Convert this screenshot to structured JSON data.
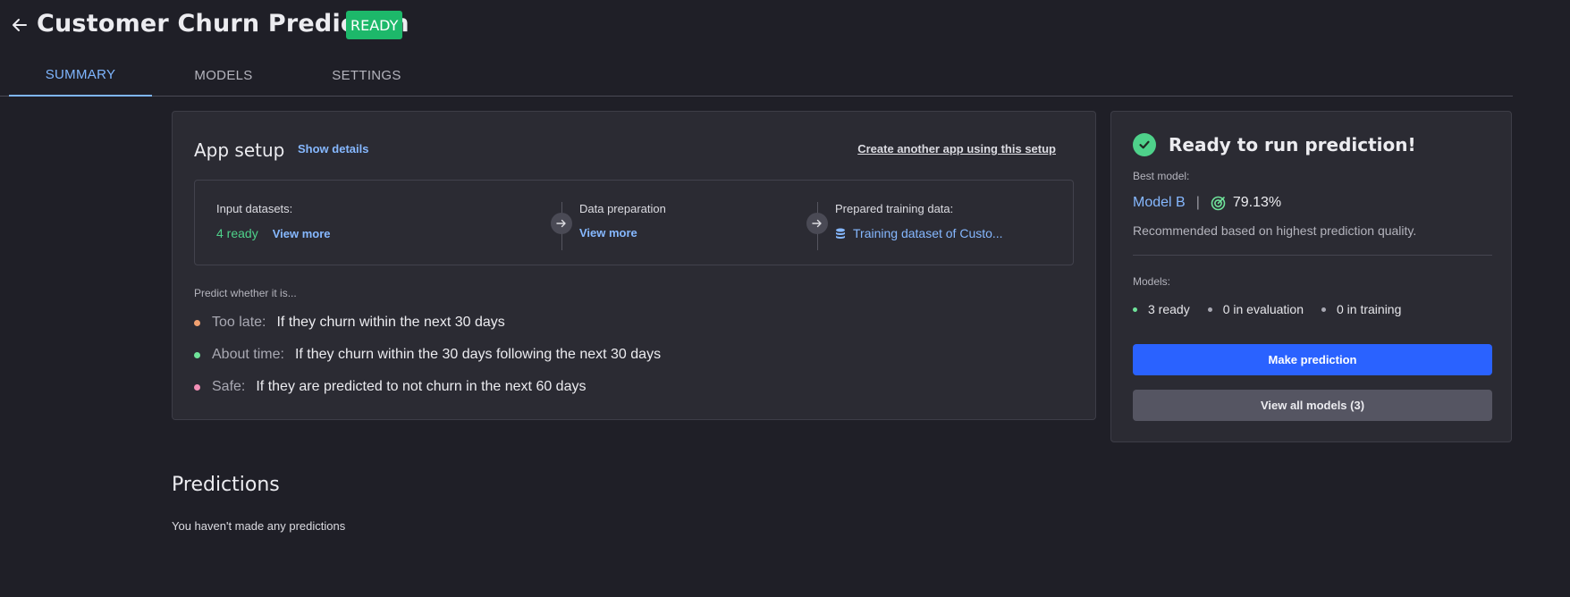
{
  "header": {
    "title": "Customer Churn Prediction",
    "status": "READY",
    "back_icon": "arrow-left-icon"
  },
  "tabs": [
    {
      "label": "SUMMARY",
      "active": true
    },
    {
      "label": "MODELS",
      "active": false
    },
    {
      "label": "SETTINGS",
      "active": false
    }
  ],
  "app_setup": {
    "title": "App setup",
    "show_details": "Show details",
    "create_another": "Create another app using this setup",
    "input_datasets": {
      "label": "Input datasets:",
      "value": "4 ready",
      "view_more": "View more"
    },
    "data_preparation": {
      "label": "Data preparation",
      "view_more": "View more"
    },
    "prepared_training_data": {
      "label": "Prepared training data:",
      "value": "Training dataset of Custo...",
      "icon": "database-icon"
    },
    "predict_label": "Predict whether it is...",
    "classes": [
      {
        "name": "Too late:",
        "description": "If they churn within the next 30 days",
        "color": "#f0a070"
      },
      {
        "name": "About time:",
        "description": "If they churn within the 30 days following the next 30 days",
        "color": "#6fe39a"
      },
      {
        "name": "Safe:",
        "description": "If they are predicted to not churn in the next 60 days",
        "color": "#f28fb6"
      }
    ]
  },
  "ready_panel": {
    "title": "Ready to run prediction!",
    "best_model_label": "Best model:",
    "best_model_name": "Model B",
    "separator": "|",
    "score": "79.13%",
    "score_icon": "target-icon",
    "recommended": "Recommended based on highest prediction quality.",
    "models_label": "Models:",
    "stats": [
      {
        "label": "3 ready",
        "color": "#6fe39a"
      },
      {
        "label": "0 in evaluation",
        "color": "#a9a9b3"
      },
      {
        "label": "0 in training",
        "color": "#a9a9b3"
      }
    ],
    "make_prediction": "Make prediction",
    "view_all_models": "View all models (3)"
  },
  "predictions": {
    "title": "Predictions",
    "empty_text": "You haven't made any predictions"
  },
  "colors": {
    "background": "#1f1f27",
    "card": "#2b2b33",
    "accent": "#86b8ff",
    "primary_button": "#2a62ff",
    "success": "#1db86a"
  }
}
